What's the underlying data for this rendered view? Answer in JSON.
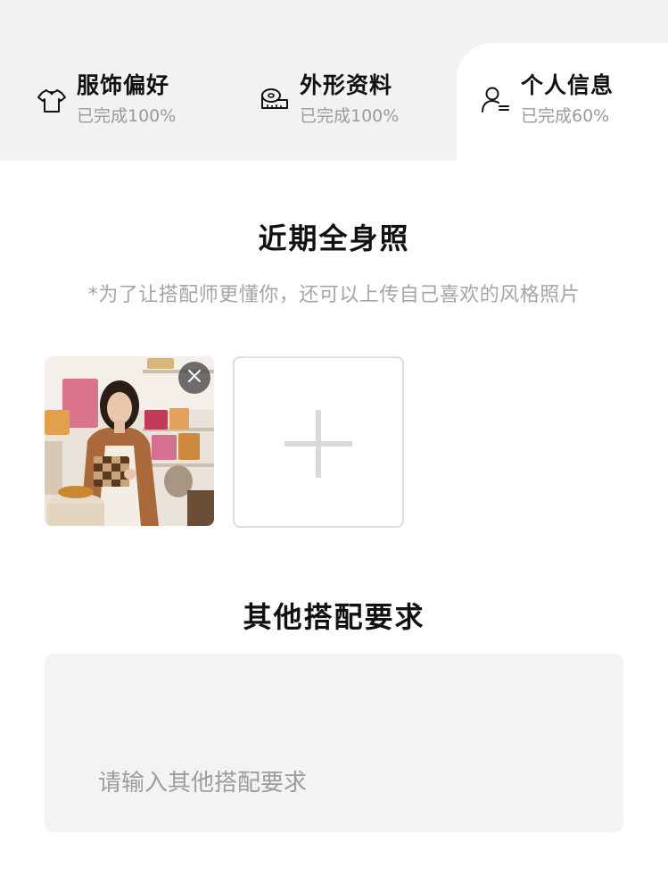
{
  "tabs": [
    {
      "title": "服饰偏好",
      "subtitle": "已完成100%",
      "progress": 100,
      "icon": "tshirt-icon",
      "active": false
    },
    {
      "title": "外形资料",
      "subtitle": "已完成100%",
      "progress": 100,
      "icon": "measuring-tape-icon",
      "active": false
    },
    {
      "title": "个人信息",
      "subtitle": "已完成60%",
      "progress": 60,
      "icon": "user-profile-icon",
      "active": true
    }
  ],
  "photo_section": {
    "title": "近期全身照",
    "hint": "*为了让搭配师更懂你，还可以上传自己喜欢的风格照片",
    "photos": [
      {
        "remove_icon": "close-icon"
      }
    ],
    "add_icon": "plus-icon"
  },
  "requirements": {
    "title": "其他搭配要求",
    "placeholder": "请输入其他搭配要求",
    "value": ""
  },
  "colors": {
    "tab_bar_bg": "#f2f2f2",
    "active_tab_bg": "#ffffff",
    "subtitle_gray": "#9a9a9a",
    "input_bg": "#f3f3f3"
  }
}
